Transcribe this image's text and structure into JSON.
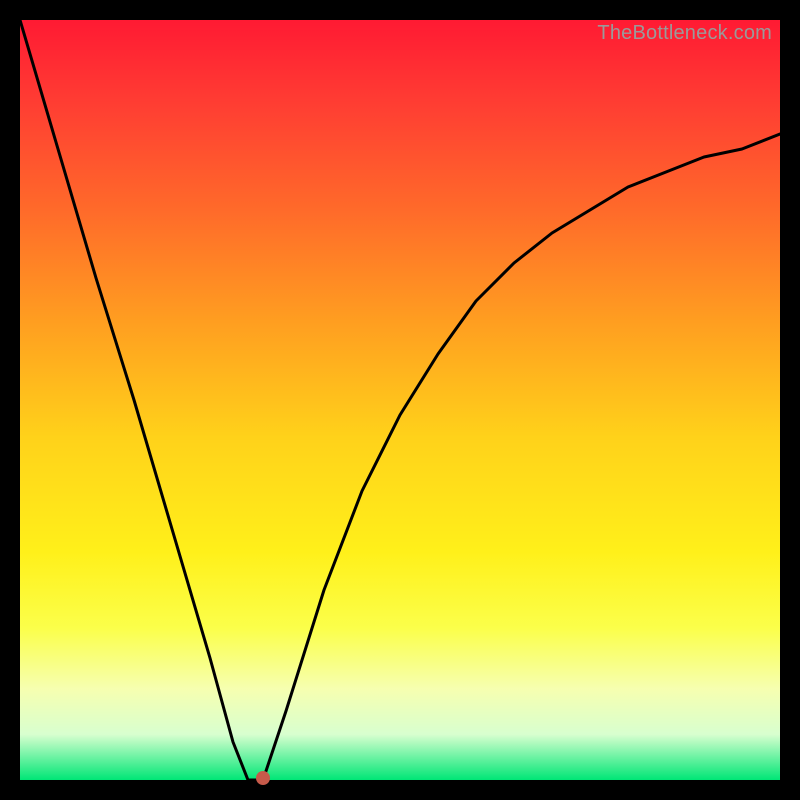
{
  "watermark": "TheBottleneck.com",
  "chart_data": {
    "type": "line",
    "title": "",
    "xlabel": "",
    "ylabel": "",
    "xlim": [
      0,
      100
    ],
    "ylim": [
      0,
      100
    ],
    "grid": false,
    "legend": false,
    "series": [
      {
        "name": "curve",
        "x": [
          0,
          5,
          10,
          15,
          20,
          25,
          28,
          30,
          32,
          35,
          40,
          45,
          50,
          55,
          60,
          65,
          70,
          75,
          80,
          85,
          90,
          95,
          100
        ],
        "y": [
          100,
          83,
          66,
          50,
          33,
          16,
          5,
          0,
          0,
          9,
          25,
          38,
          48,
          56,
          63,
          68,
          72,
          75,
          78,
          80,
          82,
          83,
          85
        ]
      }
    ],
    "marker": {
      "x": 32,
      "y": 0,
      "color": "#c65a4a"
    },
    "background": "rainbow-gradient"
  }
}
